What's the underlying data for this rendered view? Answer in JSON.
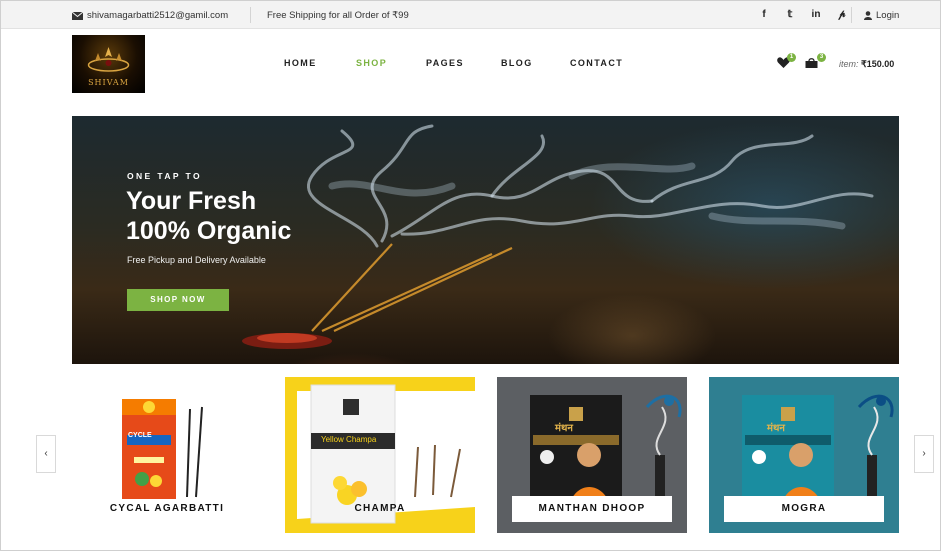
{
  "topbar": {
    "email": "shivamagarbatti2512@gamil.com",
    "shipping": "Free Shipping for all Order of ₹99",
    "socials": [
      "f",
      "𝕥",
      "in",
      "𝓅"
    ],
    "login": "Login"
  },
  "logo": {
    "text": "SHIVAM"
  },
  "nav": [
    {
      "label": "HOME",
      "active": false
    },
    {
      "label": "SHOP",
      "active": true
    },
    {
      "label": "PAGES",
      "active": false
    },
    {
      "label": "BLOG",
      "active": false
    },
    {
      "label": "CONTACT",
      "active": false
    }
  ],
  "header": {
    "wishlist_count": "1",
    "cart_count": "3",
    "items_label": "item:",
    "items_total": "₹150.00"
  },
  "hero": {
    "kicker": "ONE TAP TO",
    "title_line1": "Your Fresh",
    "title_line2": "100% Organic",
    "subtitle": "Free Pickup and Delivery Available",
    "button": "SHOP NOW"
  },
  "products": [
    {
      "name": "CYCAL AGARBATTI",
      "pack_label": "CYCLE"
    },
    {
      "name": "CHAMPA",
      "pack_label": "Yellow Champa"
    },
    {
      "name": "MANTHAN DHOOP",
      "pack_label": "मंथन"
    },
    {
      "name": "MOGRA",
      "pack_label": "मंथन"
    }
  ],
  "carousel": {
    "prev": "‹",
    "next": "›"
  },
  "colors": {
    "accent": "#7cb342",
    "topbar_bg": "#f3f3f3",
    "text": "#222222"
  }
}
